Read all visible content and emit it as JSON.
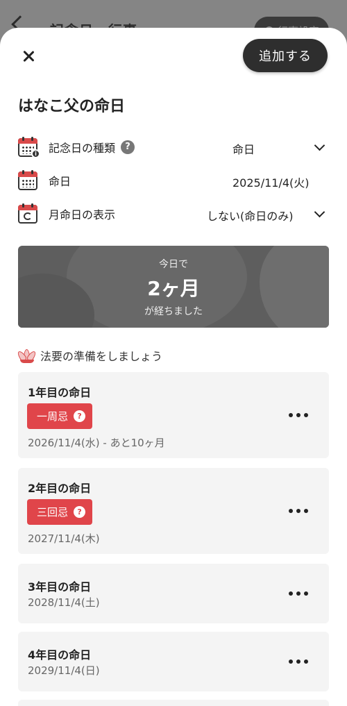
{
  "background_screen": {
    "title": "記念日・行事",
    "button_label": "行事設定"
  },
  "sheet": {
    "add_button": "追加する",
    "title": "はなこ父の命日"
  },
  "rows": [
    {
      "label": "記念日の種類",
      "value": "命日",
      "has_help": true,
      "has_dropdown": true
    },
    {
      "label": "命日",
      "value": "2025/11/4(火)",
      "has_help": false,
      "has_dropdown": false
    },
    {
      "label": "月命日の表示",
      "value": "しない(命日のみ)",
      "has_help": false,
      "has_dropdown": true
    }
  ],
  "banner": {
    "top": "今日で",
    "main": "2ヶ月",
    "bottom": "が経ちました"
  },
  "prep_heading": "法要の準備をしましょう",
  "cards": [
    {
      "title": "1年目の命日",
      "tag": "一周忌",
      "date": "2026/11/4(水) - あと10ヶ月"
    },
    {
      "title": "2年目の命日",
      "tag": "三回忌",
      "date": "2027/11/4(木)"
    },
    {
      "title": "3年目の命日",
      "tag": null,
      "date": "2028/11/4(土)"
    },
    {
      "title": "4年目の命日",
      "tag": null,
      "date": "2029/11/4(日)"
    }
  ],
  "colors": {
    "accent_red": "#e0454a",
    "dark_button": "#2e2e2e",
    "card_bg": "#f4f4f4"
  },
  "icons": [
    "close-icon",
    "calendar-info-icon",
    "calendar-icon",
    "calendar-repeat-icon",
    "help-icon",
    "chevron-down-icon",
    "lotus-icon",
    "more-icon"
  ]
}
